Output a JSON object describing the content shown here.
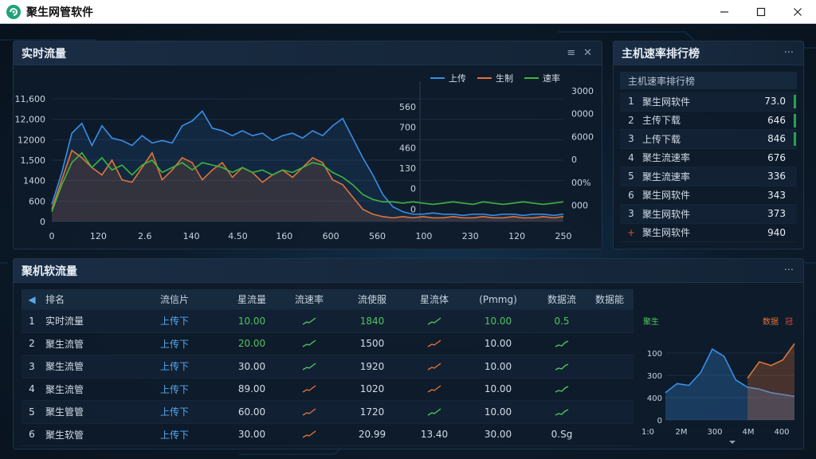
{
  "window": {
    "title": "聚生网管软件"
  },
  "traffic": {
    "title": "实时流量",
    "legend": [
      {
        "name": "上传",
        "color": "#3a8ee6"
      },
      {
        "name": "生制",
        "color": "#e0733a"
      },
      {
        "name": "速率",
        "color": "#3fb53f"
      }
    ]
  },
  "chart_data": [
    {
      "type": "line",
      "title": "实时流量",
      "y_left_ticks": [
        "11,600",
        "12,000",
        "12000",
        "1,500",
        "1400",
        "600",
        "0"
      ],
      "y_mid_ticks": [
        "560",
        "700",
        "460",
        "130",
        "0",
        "0"
      ],
      "y_right_ticks": [
        "3000",
        "0000",
        "6000",
        "0",
        "00%",
        "000"
      ],
      "x_ticks": [
        "0",
        "120",
        "2.6",
        "140",
        "4.50",
        "160",
        "600",
        "560",
        "100",
        "230",
        "120",
        "250"
      ],
      "series": [
        {
          "name": "上传",
          "color": "#3a8ee6",
          "values": [
            14,
            40,
            72,
            80,
            62,
            78,
            68,
            66,
            62,
            70,
            64,
            66,
            64,
            78,
            82,
            90,
            76,
            74,
            70,
            74,
            70,
            72,
            66,
            70,
            72,
            68,
            74,
            70,
            78,
            84,
            68,
            52,
            38,
            22,
            12,
            8,
            6,
            6,
            7,
            6,
            6,
            5,
            6,
            6,
            5,
            6,
            6,
            5,
            6,
            6,
            5,
            6
          ]
        },
        {
          "name": "生制",
          "color": "#e0733a",
          "values": [
            10,
            34,
            58,
            52,
            44,
            38,
            50,
            34,
            32,
            44,
            56,
            34,
            42,
            52,
            48,
            34,
            42,
            48,
            36,
            44,
            40,
            32,
            38,
            42,
            36,
            44,
            52,
            48,
            34,
            30,
            20,
            10,
            6,
            4,
            3,
            4,
            3,
            4,
            3,
            3,
            4,
            3,
            3,
            4,
            3,
            3,
            4,
            3,
            3,
            4,
            3,
            4
          ]
        },
        {
          "name": "速率",
          "color": "#3fb53f",
          "values": [
            8,
            30,
            48,
            56,
            44,
            52,
            42,
            46,
            38,
            46,
            50,
            40,
            44,
            48,
            42,
            48,
            46,
            44,
            40,
            44,
            40,
            42,
            38,
            42,
            40,
            44,
            48,
            46,
            40,
            36,
            30,
            22,
            18,
            16,
            16,
            15,
            16,
            15,
            14,
            15,
            16,
            15,
            14,
            16,
            15,
            14,
            15,
            16,
            15,
            14,
            15,
            16
          ]
        }
      ]
    },
    {
      "type": "area",
      "legend": [
        "聚生",
        "数据",
        "冠"
      ],
      "y_ticks": [
        "100",
        "300",
        "400",
        "0"
      ],
      "x_ticks": [
        "1:0",
        "2M",
        "300",
        "4M",
        "400"
      ],
      "series": [
        {
          "name": "聚生",
          "color": "#3a8ee6",
          "values": [
            30,
            40,
            38,
            52,
            78,
            70,
            44,
            36,
            34,
            30,
            28,
            26
          ]
        },
        {
          "name": "数据",
          "color": "#e0733a",
          "values": [
            0,
            0,
            0,
            0,
            0,
            0,
            0,
            46,
            64,
            60,
            66,
            84
          ]
        }
      ]
    }
  ],
  "ranking": {
    "title": "主机速率排行榜",
    "subtitle": "主机速率排行榜",
    "items": [
      {
        "no": "1",
        "name": "聚生网软件",
        "value": "73.0"
      },
      {
        "no": "2",
        "name": "主传下载",
        "value": "646"
      },
      {
        "no": "3",
        "name": "上传下载",
        "value": "846"
      },
      {
        "no": "4",
        "name": "聚生流速率",
        "value": "676"
      },
      {
        "no": "5",
        "name": "聚生流速率",
        "value": "336"
      },
      {
        "no": "6",
        "name": "聚生网软件",
        "value": "343"
      },
      {
        "no": "3",
        "name": "聚生网软件",
        "value": "373"
      },
      {
        "no": "+",
        "name": "聚生网软件",
        "value": "940"
      }
    ]
  },
  "table": {
    "title": "聚机软流量",
    "headers": [
      "排名",
      "流信片",
      "星流量",
      "流速率",
      "流使服",
      "星流体",
      "(Pmmg)",
      "数据流",
      "数据能"
    ],
    "rows": [
      {
        "no": "1",
        "name": "实时流量",
        "dir": "上传下",
        "v1": "10.00",
        "v2": "1840",
        "v3": "10.00",
        "v4": "0.5"
      },
      {
        "no": "2",
        "name": "聚生流管",
        "dir": "上传下",
        "v1": "20.00",
        "v2": "1500",
        "v3": "10.00",
        "v4": ""
      },
      {
        "no": "3",
        "name": "聚生流管",
        "dir": "上传下",
        "v1": "30.00",
        "v2": "1920",
        "v3": "10.00",
        "v4": ""
      },
      {
        "no": "4",
        "name": "聚生流管",
        "dir": "上传下",
        "v1": "89.00",
        "v2": "1020",
        "v3": "10.00",
        "v4": ""
      },
      {
        "no": "5",
        "name": "聚生管管",
        "dir": "上传下",
        "v1": "60.00",
        "v2": "1720",
        "v3": "10.00",
        "v4": ""
      },
      {
        "no": "6",
        "name": "聚生软管",
        "dir": "上传下",
        "v1": "30.00",
        "v2": "20.99",
        "v3": "30.00",
        "v4": "0.Sg",
        "extra": "13.40"
      }
    ]
  }
}
